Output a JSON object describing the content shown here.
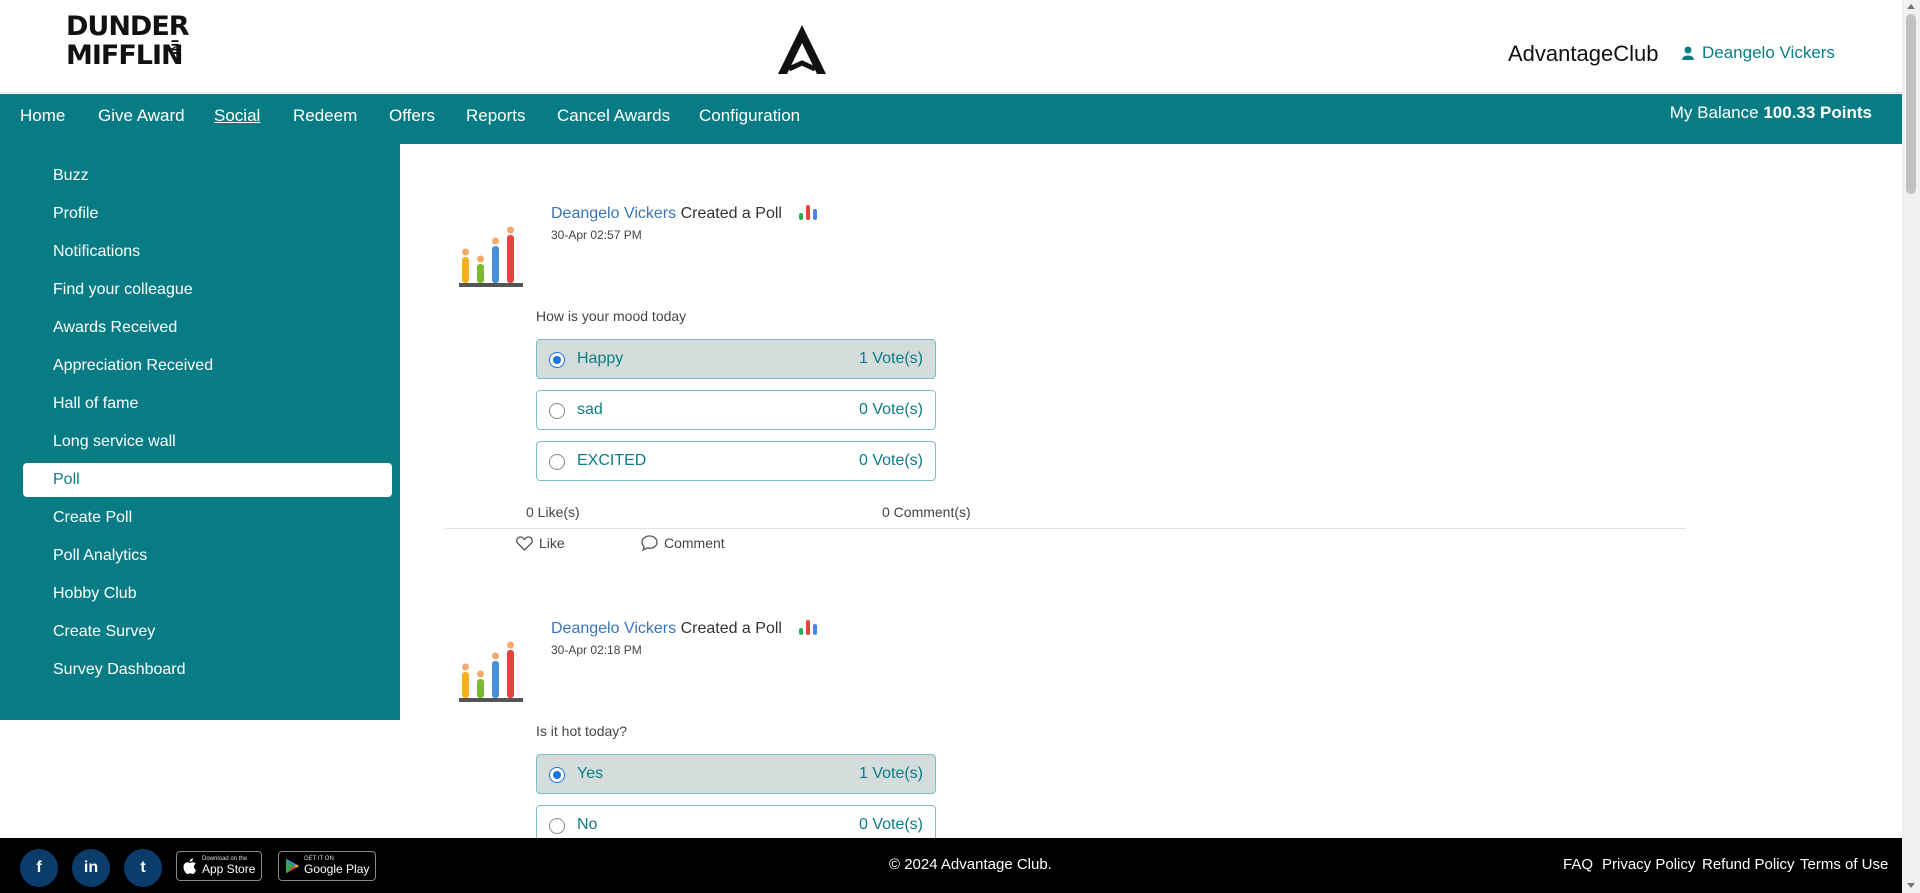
{
  "header": {
    "logo_text_line1": "DUNDER",
    "logo_text_line2": "MIFFLIN",
    "logo_suffix": "INC",
    "brand": "AdvantageClub",
    "user_name": "Deangelo Vickers",
    "logo_icon": "advantage-a-logo",
    "user_icon": "user-icon"
  },
  "nav": {
    "items": [
      "Home",
      "Give Award",
      "Social",
      "Redeem",
      "Offers",
      "Reports",
      "Cancel Awards",
      "Configuration"
    ],
    "active": "Social",
    "balance_label": "My Balance",
    "balance_value": "100.33 Points"
  },
  "sidebar": {
    "items": [
      "Buzz",
      "Profile",
      "Notifications",
      "Find your colleague",
      "Awards Received",
      "Appreciation Received",
      "Hall of fame",
      "Long service wall",
      "Poll",
      "Create Poll",
      "Poll Analytics",
      "Hobby Club",
      "Create Survey",
      "Survey Dashboard"
    ],
    "active": "Poll"
  },
  "posts": [
    {
      "author": "Deangelo Vickers",
      "action": "Created a Poll",
      "time": "30-Apr 02:57 PM",
      "question": "How is your mood today",
      "options": [
        {
          "label": "Happy",
          "votes": "1 Vote(s)",
          "selected": true
        },
        {
          "label": "sad",
          "votes": "0 Vote(s)",
          "selected": false
        },
        {
          "label": "EXCITED",
          "votes": "0 Vote(s)",
          "selected": false
        }
      ],
      "likes": "0 Like(s)",
      "comments": "0 Comment(s)",
      "like_label": "Like",
      "comment_label": "Comment"
    },
    {
      "author": "Deangelo Vickers",
      "action": "Created a Poll",
      "time": "30-Apr 02:18 PM",
      "question": "Is it hot today?",
      "options": [
        {
          "label": "Yes",
          "votes": "1 Vote(s)",
          "selected": true
        },
        {
          "label": "No",
          "votes": "0 Vote(s)",
          "selected": false
        }
      ]
    }
  ],
  "footer": {
    "social": [
      "f",
      "in",
      "t"
    ],
    "social_icons": [
      "facebook-icon",
      "linkedin-icon",
      "twitter-icon"
    ],
    "app_store_small": "Download on the",
    "app_store_big": "App Store",
    "google_play_small": "GET IT ON",
    "google_play_big": "Google Play",
    "copyright": "© 2024 Advantage Club.",
    "links": [
      "FAQ",
      "Privacy Policy",
      "Refund Policy",
      "Terms of Use"
    ]
  },
  "colors": {
    "teal": "#087c84",
    "link_blue": "#3b74b7",
    "selected_option_bg": "#d4dcdc",
    "footer_bg": "#000000"
  }
}
